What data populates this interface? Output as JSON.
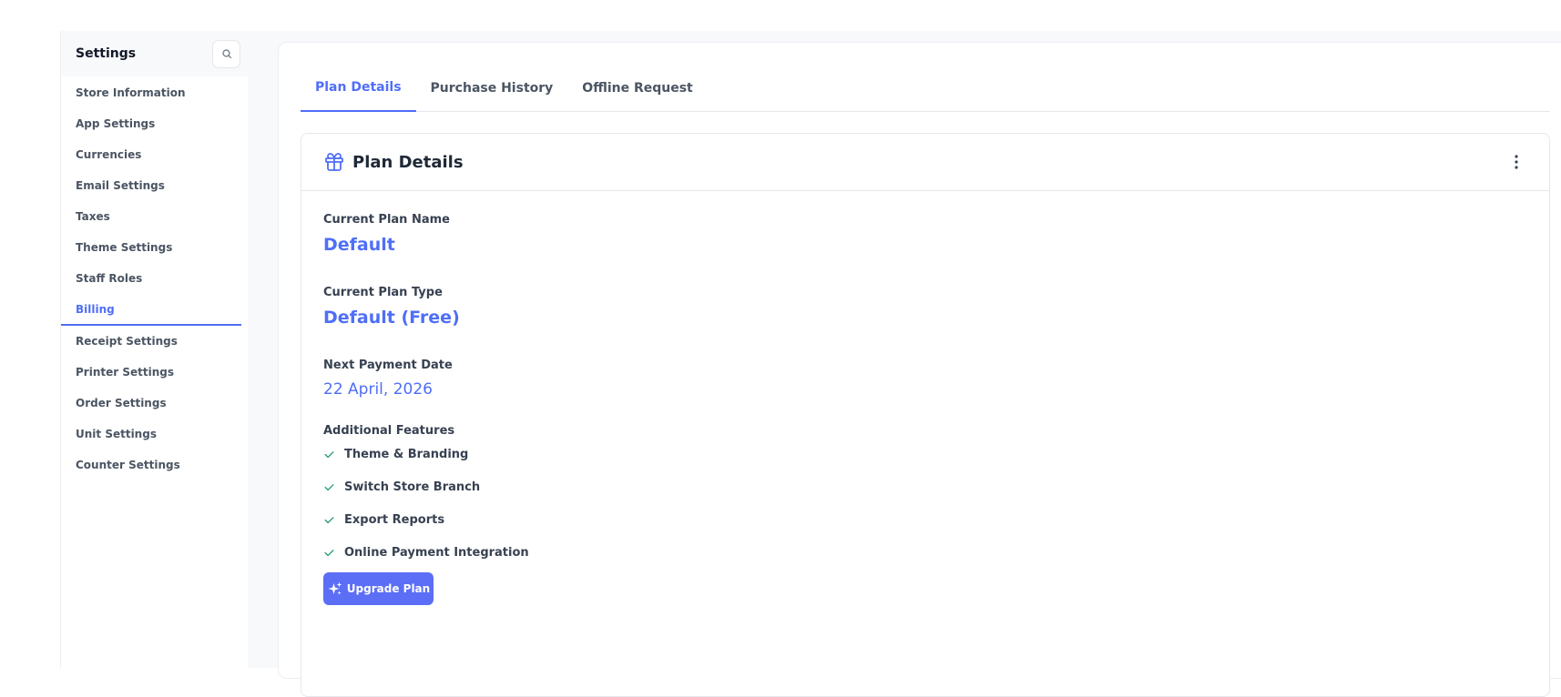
{
  "sidebar": {
    "title": "Settings",
    "search_icon": "search-icon",
    "items": [
      {
        "label": "Store Information",
        "active": false
      },
      {
        "label": "App Settings",
        "active": false
      },
      {
        "label": "Currencies",
        "active": false
      },
      {
        "label": "Email Settings",
        "active": false
      },
      {
        "label": "Taxes",
        "active": false
      },
      {
        "label": "Theme Settings",
        "active": false
      },
      {
        "label": "Staff Roles",
        "active": false
      },
      {
        "label": "Billing",
        "active": true
      },
      {
        "label": "Receipt Settings",
        "active": false
      },
      {
        "label": "Printer Settings",
        "active": false
      },
      {
        "label": "Order Settings",
        "active": false
      },
      {
        "label": "Unit Settings",
        "active": false
      },
      {
        "label": "Counter Settings",
        "active": false
      }
    ]
  },
  "tabs": [
    {
      "label": "Plan Details",
      "active": true
    },
    {
      "label": "Purchase History",
      "active": false
    },
    {
      "label": "Offline Request",
      "active": false
    }
  ],
  "card": {
    "title": "Plan Details",
    "icon": "gift-icon",
    "menu_icon": "more-vertical-icon",
    "current_plan_name_label": "Current Plan Name",
    "current_plan_name": "Default",
    "current_plan_type_label": "Current Plan Type",
    "current_plan_type": "Default (Free)",
    "next_payment_date_label": "Next Payment Date",
    "next_payment_date": "22 April, 2026",
    "additional_features_label": "Additional Features",
    "features": [
      "Theme & Branding",
      "Switch Store Branch",
      "Export Reports",
      "Online Payment Integration"
    ],
    "upgrade_button_label": "Upgrade Plan",
    "upgrade_icon": "sparkles-icon"
  },
  "colors": {
    "accent": "#4f6ef7",
    "button": "#5b6ef5",
    "check": "#22a06b"
  }
}
